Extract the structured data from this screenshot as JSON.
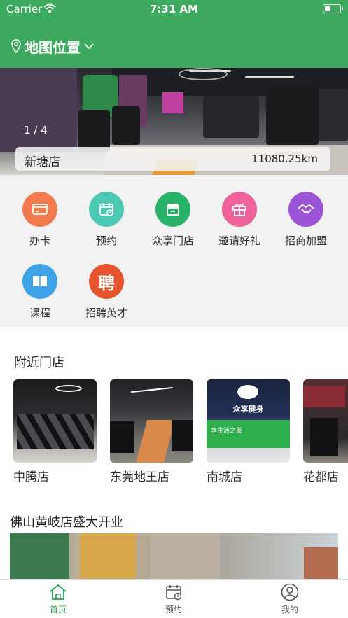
{
  "status_bar": {
    "carrier": "Carrier",
    "time": "7:31 AM",
    "battery_level": 0.4
  },
  "header": {
    "location_label": "地图位置"
  },
  "banner": {
    "counter": "1 / 4",
    "store_name": "新塘店",
    "distance": "11080.25km"
  },
  "menu": [
    {
      "label": "办卡",
      "icon": "card-icon",
      "color": "#f27a4e"
    },
    {
      "label": "预约",
      "icon": "calendar-icon",
      "color": "#4cc9b4"
    },
    {
      "label": "众享门店",
      "icon": "store-icon",
      "color": "#29b36a"
    },
    {
      "label": "邀请好礼",
      "icon": "gift-icon",
      "color": "#f0629a"
    },
    {
      "label": "招商加盟",
      "icon": "handshake-icon",
      "color": "#9b54d6"
    },
    {
      "label": "课程",
      "icon": "book-icon",
      "color": "#3fa3e8"
    },
    {
      "label": "招聘英才",
      "icon": "recruit-icon",
      "icon_text": "聘",
      "color": "#e5542d"
    }
  ],
  "nearby": {
    "title": "附近门店",
    "stores": [
      {
        "name": "中腾店"
      },
      {
        "name": "东莞地王店"
      },
      {
        "name": "南城店",
        "sign": "众享健身",
        "slogan": "享生活之美"
      },
      {
        "name": "花都店"
      }
    ]
  },
  "news": {
    "title": "佛山黄岐店盛大开业"
  },
  "tabbar": {
    "tabs": [
      {
        "label": "首页",
        "icon": "home-icon",
        "active": true
      },
      {
        "label": "预约",
        "icon": "calendar-icon",
        "active": false
      },
      {
        "label": "我的",
        "icon": "user-icon",
        "active": false
      }
    ]
  },
  "colors": {
    "primary": "#3daa5f",
    "background": "#f2f2f2"
  }
}
